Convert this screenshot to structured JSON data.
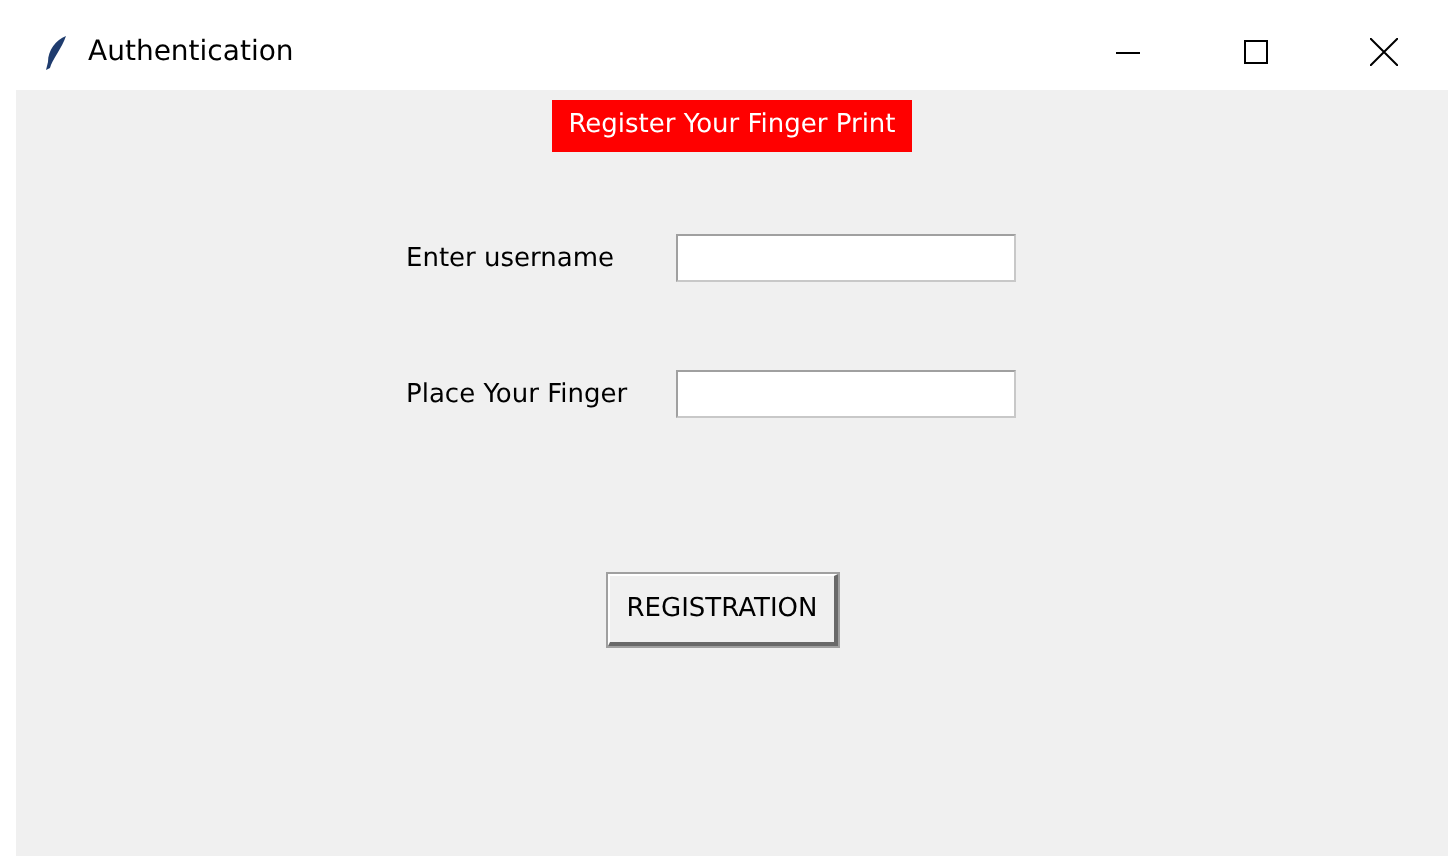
{
  "window": {
    "title": "Authentication"
  },
  "banner": "Register Your Finger Print",
  "fields": [
    {
      "label": "Enter username"
    },
    {
      "label": "Place Your Finger"
    }
  ],
  "button": "REGISTRATION"
}
